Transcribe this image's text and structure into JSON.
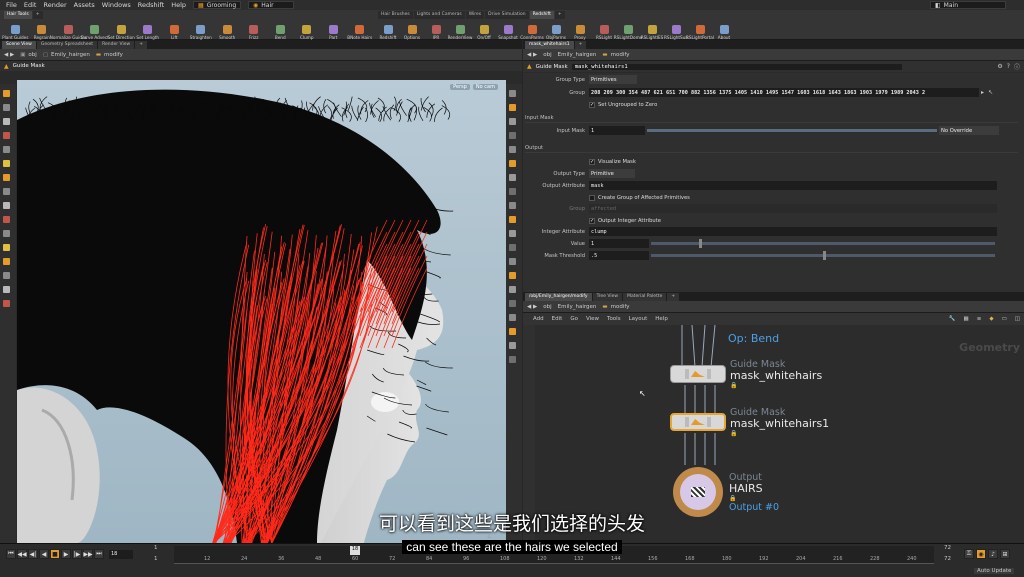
{
  "menu": {
    "items": [
      "File",
      "Edit",
      "Render",
      "Assets",
      "Windows",
      "Redshift",
      "Help"
    ],
    "desktop": "Grooming",
    "context": "Hair",
    "main": "Main"
  },
  "shelf": {
    "left_tabs": [
      "Hair Tools"
    ],
    "left_tools": [
      "Plant Guides",
      "Regrain",
      "Normalize Guides",
      "Curve Advect",
      "Set Direction",
      "Set Length",
      "Lift",
      "Straighten",
      "Smooth",
      "Frizz",
      "Bend",
      "Clump",
      "Part",
      "BNote Hairs"
    ],
    "right_tabs": [
      "Hair Brushes",
      "Lights and Cameras",
      "Wires",
      "Drive Simulation",
      "Redshift"
    ],
    "right_tools": [
      "Redshift",
      "Options",
      "IPR",
      "RenderView",
      "On/Off",
      "Snapshot",
      "ConnParms",
      "ObjParms",
      "Proxy",
      "RSLight",
      "RSLightDome",
      "RSLightIES",
      "RSLightSun",
      "RSLightPortal",
      "About"
    ]
  },
  "viewer": {
    "tabs": [
      "Scene View",
      "Geometry Spreadsheet",
      "Render View"
    ],
    "path": [
      "obj",
      "Emily_hairgen",
      "modify"
    ],
    "title": "Guide Mask",
    "persp_label": "Persp",
    "cam_label": "No cam"
  },
  "params": {
    "tab": "mask_whitehairs1",
    "path": [
      "obj",
      "Emily_hairgen",
      "modify"
    ],
    "node_type": "Guide Mask",
    "node_name": "mask_whitehairs1",
    "group_type_label": "Group Type",
    "group_type_value": "Primitives",
    "group_label": "Group",
    "group_value": "208 209 300 354 487 621 651 700 882 1356 1375 1405 1410 1495 1547 1603 1618 1643 1863 1903 1979 1989 2043 2",
    "ungroup_label": "Set Ungrouped to Zero",
    "input_mask_section": "Input Mask",
    "input_mask_label": "Input Mask",
    "input_mask_value": "1",
    "override_value": "No Override",
    "output_section": "Output",
    "visualize_label": "Visualize Mask",
    "output_type_label": "Output Type",
    "output_type_value": "Primitive",
    "output_attr_label": "Output Attribute",
    "output_attr_value": "mask",
    "create_group_label": "Create Group of Affected Primitives",
    "group2_label": "Group",
    "group2_value": "affected",
    "output_int_label": "Output Integer Attribute",
    "int_attr_label": "Integer Attribute",
    "int_attr_value": "clump",
    "value_label": "Value",
    "value_value": "1",
    "threshold_label": "Mask Threshold",
    "threshold_value": ".5",
    "value_slider_fraction": 0.14,
    "threshold_slider_fraction": 0.5,
    "input_mask_slider_fraction": 1.0
  },
  "network": {
    "tabs": [
      "/obj/Emily_hairgen/modify",
      "Tree View",
      "Material Palette"
    ],
    "path": [
      "obj",
      "Emily_hairgen",
      "modify"
    ],
    "menu": [
      "Add",
      "Edit",
      "Go",
      "View",
      "Tools",
      "Layout",
      "Help"
    ],
    "context_label": "Geometry",
    "nodes": [
      {
        "type": "",
        "name": "Op: Bend"
      },
      {
        "type": "Guide Mask",
        "name": "mask_whitehairs"
      },
      {
        "type": "Guide Mask",
        "name": "mask_whitehairs1"
      },
      {
        "type": "Output",
        "name": "HAIRS",
        "extra": "Output #0"
      }
    ]
  },
  "timeline": {
    "frame": "18",
    "start": "1",
    "end": "1",
    "ticks": [
      "12",
      "24",
      "36",
      "48",
      "60",
      "72",
      "84",
      "96",
      "108",
      "120",
      "132",
      "144",
      "156",
      "168",
      "180",
      "192",
      "204",
      "216",
      "228",
      "240"
    ],
    "end_field_1": "72",
    "end_field_2": "72",
    "auto_update": "Auto Update"
  },
  "subtitles": {
    "chinese": "可以看到这些是我们选择的头发",
    "english": "can see these are the hairs we selected"
  },
  "colors": {
    "accent": "#e49b2a",
    "selected_node": "#e8a532",
    "output_ring": "#c08a4a",
    "hair_red": "#ff2a1a",
    "sky": "#a9bfcc"
  }
}
